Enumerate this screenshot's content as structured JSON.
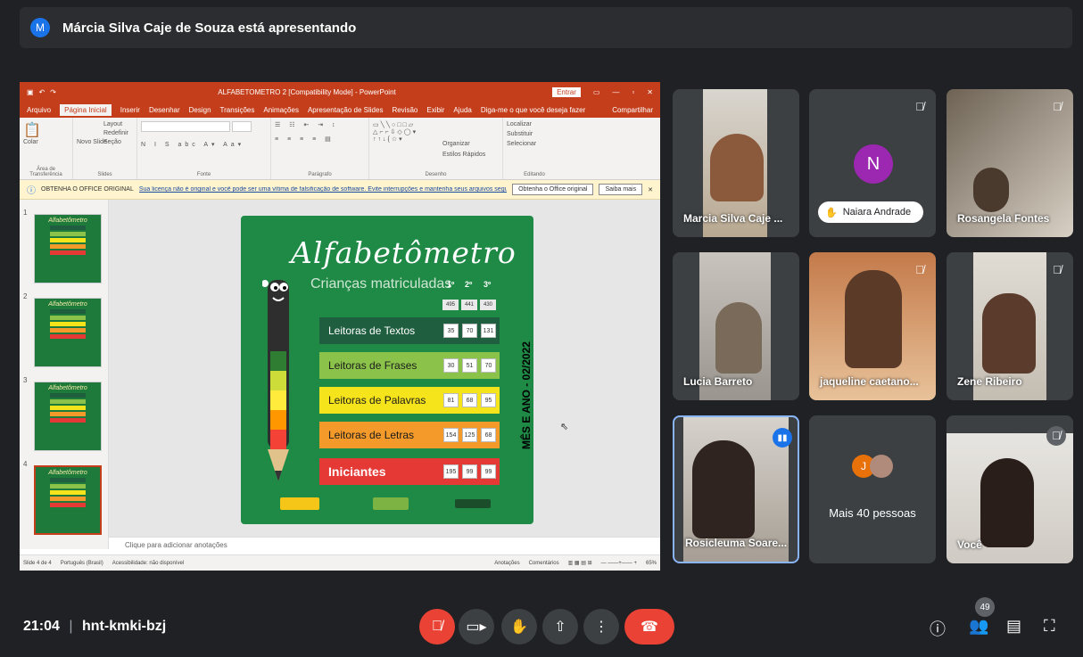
{
  "presenter": {
    "initial": "M",
    "text": "Márcia Silva Caje de Souza está apresentando"
  },
  "powerpoint": {
    "title": "ALFABETOMETRO 2 [Compatibility Mode] - PowerPoint",
    "signin": "Entrar",
    "tabs": [
      "Arquivo",
      "Página Inicial",
      "Inserir",
      "Desenhar",
      "Design",
      "Transições",
      "Animações",
      "Apresentação de Slides",
      "Revisão",
      "Exibir",
      "Ajuda",
      "Diga-me o que você deseja fazer"
    ],
    "share": "Compartilhar",
    "ribbon_groups": [
      "Área de Transferência",
      "Slides",
      "Fonte",
      "Parágrafo",
      "Desenho",
      "Editando"
    ],
    "ribbon_items": {
      "paste": "Colar",
      "new_slide": "Novo Slide",
      "layout": "Layout",
      "reset": "Redefinir",
      "section": "Seção",
      "arrange": "Organizar",
      "quick_styles": "Estilos Rápidos",
      "find": "Localizar",
      "replace": "Substituir",
      "select": "Selecionar"
    },
    "message": {
      "label": "OBTENHA O OFFICE ORIGINAL",
      "text": "Sua licença não é original e você pode ser uma vítima de falsificação de software. Evite interrupções e mantenha seus arquivos seguros com o Office original hoje mesmo.",
      "button1": "Obtenha o Office original",
      "button2": "Saiba mais"
    },
    "thumb_title": "Alfabetômetro",
    "slide_numbers": [
      "1",
      "2",
      "3",
      "4"
    ],
    "notes_placeholder": "Clique para adicionar anotações",
    "status": {
      "slide": "Slide 4 de 4",
      "lang": "Português (Brasil)",
      "access": "Acessibilidade: não disponível",
      "notes": "Anotações",
      "comments": "Comentários",
      "zoom": "65%"
    }
  },
  "slide": {
    "title": "Alfabetômetro",
    "subtitle": "Crianças matriculadas",
    "columns": [
      "1º",
      "2º",
      "3º"
    ],
    "totals": [
      "495",
      "441",
      "430"
    ],
    "rows": [
      {
        "label": "Leitoras de Textos",
        "values": [
          "35",
          "70",
          "131"
        ],
        "color": "#1f5e3f",
        "text_color": "#ffffff"
      },
      {
        "label": "Leitoras de Frases",
        "values": [
          "30",
          "51",
          "70"
        ],
        "color": "#8bc34a",
        "text_color": "#1b1b1b"
      },
      {
        "label": "Leitoras de Palavras",
        "values": [
          "81",
          "68",
          "95"
        ],
        "color": "#f5e31b",
        "text_color": "#1b1b1b"
      },
      {
        "label": "Leitoras de Letras",
        "values": [
          "154",
          "125",
          "68"
        ],
        "color": "#f39a2b",
        "text_color": "#1b1b1b"
      },
      {
        "label": "Iniciantes",
        "values": [
          "195",
          "99",
          "99"
        ],
        "color": "#e53935",
        "text_color": "#ffffff"
      }
    ],
    "side_text": "MÊS E ANO - 02/2022"
  },
  "participants": [
    {
      "name": "Marcia Silva Caje ...",
      "muted": false
    },
    {
      "name": "Naiara Andrade",
      "initial": "N",
      "muted": true
    },
    {
      "name": "Rosangela Fontes",
      "muted": true
    },
    {
      "name": "Lucia Barreto",
      "muted": false
    },
    {
      "name": "jaqueline caetano...",
      "muted": true
    },
    {
      "name": "Zene Ribeiro",
      "muted": true
    },
    {
      "name": "Rosicleuma Soare...",
      "speaking": true
    },
    {
      "name": "Mais 40 pessoas",
      "initial": "J"
    },
    {
      "name": "Você",
      "muted": true
    }
  ],
  "bottom": {
    "time": "21:04",
    "separator": "|",
    "meeting_code": "hnt-kmki-bzj",
    "participant_count": "49"
  },
  "colors": {
    "background": "#202124",
    "tile": "#3c4043",
    "red": "#ea4335",
    "ppt": "#c43e1c",
    "slide_green": "#1e8a45"
  }
}
